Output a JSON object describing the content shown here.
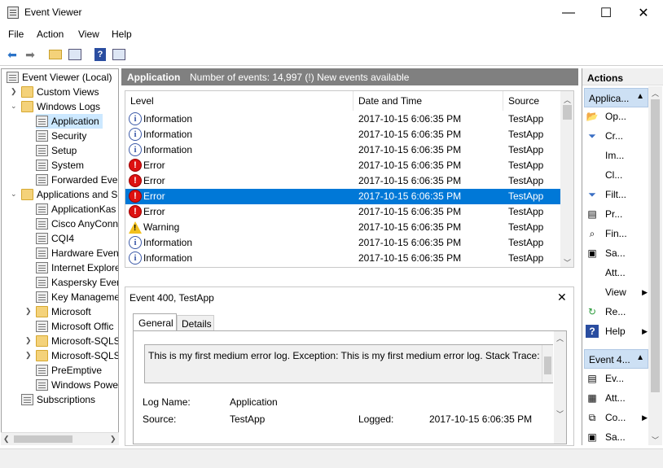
{
  "window": {
    "title": "Event Viewer",
    "minimize": "—",
    "maximize": "☐",
    "close": "✕"
  },
  "menu": [
    "File",
    "Action",
    "View",
    "Help"
  ],
  "tree": {
    "root": "Event Viewer (Local)",
    "items": [
      {
        "label": "Custom Views",
        "icon": "folder-icon"
      },
      {
        "label": "Windows Logs",
        "icon": "folder-icon"
      },
      {
        "label": "Application",
        "icon": "log-icon",
        "selected": true
      },
      {
        "label": "Security",
        "icon": "log-icon"
      },
      {
        "label": "Setup",
        "icon": "log-icon"
      },
      {
        "label": "System",
        "icon": "log-icon"
      },
      {
        "label": "Forwarded Even",
        "icon": "log-icon"
      },
      {
        "label": "Applications and S",
        "icon": "folder-icon"
      },
      {
        "label": "ApplicationKas",
        "icon": "log-icon"
      },
      {
        "label": "Cisco AnyConn",
        "icon": "log-icon"
      },
      {
        "label": "CQI4",
        "icon": "log-icon"
      },
      {
        "label": "Hardware Even",
        "icon": "log-icon"
      },
      {
        "label": "Internet Explore",
        "icon": "log-icon"
      },
      {
        "label": "Kaspersky Even",
        "icon": "log-icon"
      },
      {
        "label": "Key Manageme",
        "icon": "log-icon"
      },
      {
        "label": "Microsoft",
        "icon": "folder-icon"
      },
      {
        "label": "Microsoft Offic",
        "icon": "log-icon"
      },
      {
        "label": "Microsoft-SQLS",
        "icon": "folder-icon"
      },
      {
        "label": "Microsoft-SQLS",
        "icon": "folder-icon"
      },
      {
        "label": "PreEmptive",
        "icon": "log-icon"
      },
      {
        "label": "Windows Powe",
        "icon": "log-icon"
      },
      {
        "label": "Subscriptions",
        "icon": "log-icon"
      }
    ]
  },
  "center": {
    "title": "Application",
    "count_text": "Number of events: 14,997 (!) New events available",
    "columns": [
      "Level",
      "Date and Time",
      "Source"
    ],
    "rows": [
      {
        "level": "Information",
        "type": "info",
        "date": "2017-10-15 6:06:35 PM",
        "source": "TestApp"
      },
      {
        "level": "Information",
        "type": "info",
        "date": "2017-10-15 6:06:35 PM",
        "source": "TestApp"
      },
      {
        "level": "Information",
        "type": "info",
        "date": "2017-10-15 6:06:35 PM",
        "source": "TestApp"
      },
      {
        "level": "Error",
        "type": "error",
        "date": "2017-10-15 6:06:35 PM",
        "source": "TestApp"
      },
      {
        "level": "Error",
        "type": "error",
        "date": "2017-10-15 6:06:35 PM",
        "source": "TestApp"
      },
      {
        "level": "Error",
        "type": "error",
        "date": "2017-10-15 6:06:35 PM",
        "source": "TestApp",
        "selected": true
      },
      {
        "level": "Error",
        "type": "error",
        "date": "2017-10-15 6:06:35 PM",
        "source": "TestApp"
      },
      {
        "level": "Warning",
        "type": "warning",
        "date": "2017-10-15 6:06:35 PM",
        "source": "TestApp"
      },
      {
        "level": "Information",
        "type": "info",
        "date": "2017-10-15 6:06:35 PM",
        "source": "TestApp"
      },
      {
        "level": "Information",
        "type": "info",
        "date": "2017-10-15 6:06:35 PM",
        "source": "TestApp"
      }
    ]
  },
  "detail": {
    "title": "Event 400, TestApp",
    "tabs": [
      "General",
      "Details"
    ],
    "message": "This is my first medium error log. Exception: This is my first medium error log. Stack Trace:",
    "log_name_label": "Log Name:",
    "log_name_value": "Application",
    "source_label": "Source:",
    "source_value": "TestApp",
    "logged_label": "Logged:",
    "logged_value": "2017-10-15 6:06:35 PM"
  },
  "actions": {
    "title": "Actions",
    "section1": "Applica...",
    "items1": [
      {
        "label": "Op...",
        "icon": "open-folder-icon"
      },
      {
        "label": "Cr...",
        "icon": "create-filter-icon"
      },
      {
        "label": "Im...",
        "icon": ""
      },
      {
        "label": "Cl...",
        "icon": ""
      },
      {
        "label": "Filt...",
        "icon": "filter-icon"
      },
      {
        "label": "Pr...",
        "icon": "properties-icon"
      },
      {
        "label": "Fin...",
        "icon": "find-icon"
      },
      {
        "label": "Sa...",
        "icon": "save-icon"
      },
      {
        "label": "Att...",
        "icon": ""
      },
      {
        "label": "View",
        "icon": "",
        "submenu": true
      },
      {
        "label": "Re...",
        "icon": "refresh-icon"
      },
      {
        "label": "Help",
        "icon": "help-icon",
        "submenu": true
      }
    ],
    "section2": "Event 4...",
    "items2": [
      {
        "label": "Ev...",
        "icon": "event-properties-icon"
      },
      {
        "label": "Att...",
        "icon": "attach-task-icon"
      },
      {
        "label": "Co...",
        "icon": "copy-icon",
        "submenu": true
      },
      {
        "label": "Sa...",
        "icon": "save-icon"
      }
    ]
  }
}
